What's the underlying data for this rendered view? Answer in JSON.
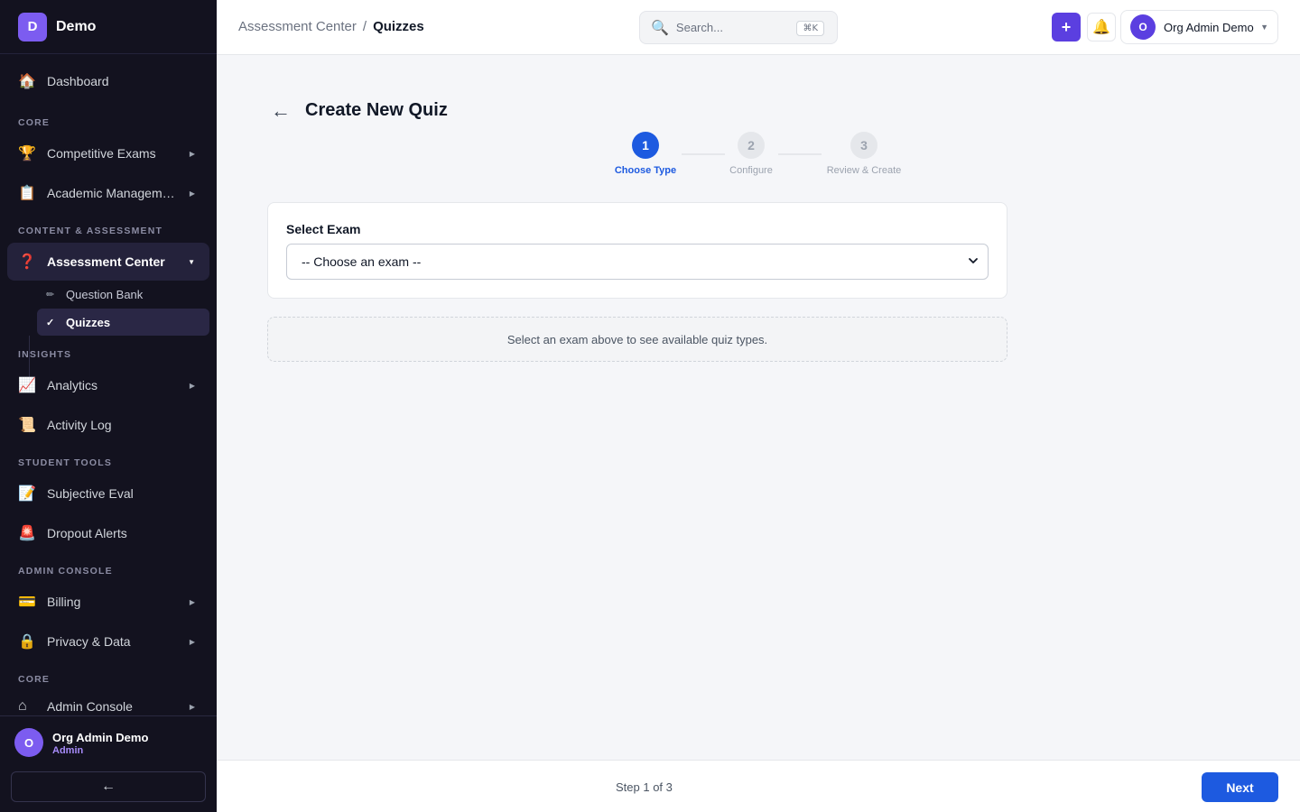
{
  "app": {
    "logo_letter": "D",
    "name": "Demo"
  },
  "sidebar": {
    "dashboard": {
      "label": "Dashboard",
      "icon": "🏠"
    },
    "sections": [
      "CORE",
      "CONTENT & ASSESSMENT",
      "INSIGHTS",
      "STUDENT TOOLS",
      "ADMIN CONSOLE",
      "CORE"
    ],
    "items": [
      {
        "label": "Competitive Exams",
        "icon": "🏆"
      },
      {
        "label": "Academic Management",
        "icon": "📋"
      },
      {
        "label": "Assessment Center",
        "icon": "❓"
      },
      {
        "label": "Analytics",
        "icon": "📈"
      },
      {
        "label": "Activity Log",
        "icon": "📜"
      },
      {
        "label": "Subjective Eval",
        "icon": "📝"
      },
      {
        "label": "Dropout Alerts",
        "icon": "🚨"
      },
      {
        "label": "Billing",
        "icon": "💳"
      },
      {
        "label": "Privacy & Data",
        "icon": "🔒"
      },
      {
        "label": "Admin Console",
        "icon": "⌂"
      }
    ],
    "sub_items": [
      {
        "label": "Question Bank",
        "icon": "✏"
      },
      {
        "label": "Quizzes",
        "icon": "✓"
      }
    ],
    "user": {
      "initial": "O",
      "name": "Org Admin Demo",
      "role": "Admin"
    },
    "collapse_icon": "←"
  },
  "header": {
    "breadcrumb": {
      "parent": "Assessment Center",
      "separator": "/",
      "current": "Quizzes"
    },
    "search": {
      "placeholder": "Search...",
      "shortcut": "⌘K",
      "icon": "🔍"
    },
    "add_icon": "+",
    "bell_icon": "🔔",
    "account": {
      "initial": "O",
      "name": "Org Admin Demo",
      "caret": "▼"
    }
  },
  "main": {
    "back_icon": "←",
    "title": "Create New Quiz",
    "steps": [
      {
        "number": "1",
        "label": "Choose Type"
      },
      {
        "number": "2",
        "label": "Configure"
      },
      {
        "number": "3",
        "label": "Review & Create"
      }
    ],
    "current_step": 1,
    "exam": {
      "label": "Select Exam",
      "selected": "-- Choose an exam --"
    },
    "hint": "Select an exam above to see available quiz types."
  },
  "footer": {
    "step_text": "Step 1 of 3",
    "next_label": "Next"
  },
  "colors": {
    "primary": "#1d5ae0",
    "accent": "#5b3fe0",
    "sidebar_bg": "#13121f",
    "avatar": "#7c5cf0"
  }
}
